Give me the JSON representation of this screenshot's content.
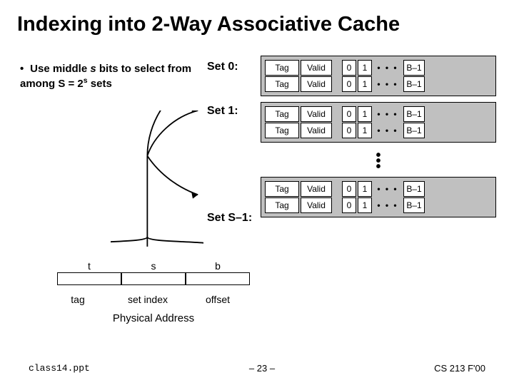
{
  "title": "Indexing into 2-Way Associative Cache",
  "bullet": {
    "lead": "•",
    "text_pre": "Use middle ",
    "s": "s",
    "text_mid": " bits to select from among S = 2",
    "sup": "s",
    "text_post": " sets"
  },
  "sets": {
    "label0": "Set 0:",
    "label1": "Set 1:",
    "labelLast": "Set S–1:"
  },
  "line": {
    "tag": "Tag",
    "valid": "Valid",
    "i0": "0",
    "i1": "1",
    "dots": "• • •",
    "bm1": "B–1"
  },
  "vellipsis": "•",
  "addr": {
    "t": "t",
    "s": "s",
    "b": "b",
    "tag": "tag",
    "setidx": "set index",
    "offset": "offset",
    "phys": "Physical Address"
  },
  "footer": {
    "file": "class14.ppt",
    "page": "– 23 –",
    "course": "CS 213 F'00"
  }
}
